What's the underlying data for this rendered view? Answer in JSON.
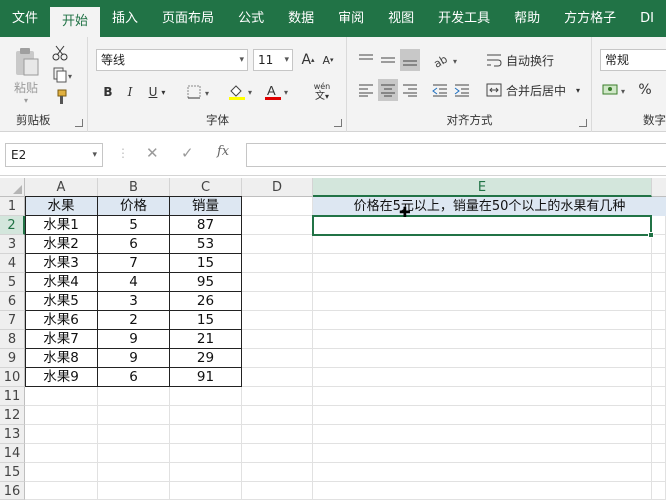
{
  "tabs": [
    "文件",
    "开始",
    "插入",
    "页面布局",
    "公式",
    "数据",
    "审阅",
    "视图",
    "开发工具",
    "帮助",
    "方方格子",
    "DI"
  ],
  "active_tab": "开始",
  "ribbon": {
    "clipboard": {
      "paste": "粘贴",
      "label": "剪贴板"
    },
    "font": {
      "name": "等线",
      "size": "11",
      "grow": "A",
      "shrink": "A",
      "bold": "B",
      "italic": "I",
      "underline": "U",
      "phonetic": "wén",
      "label": "字体"
    },
    "alignment": {
      "wrap": "自动换行",
      "merge": "合并后居中",
      "label": "对齐方式"
    },
    "number": {
      "format": "常规",
      "percent": "%",
      "label": "数字"
    }
  },
  "formula_bar": {
    "name_box": "E2",
    "fx": "fx",
    "value": ""
  },
  "columns": [
    {
      "id": "A",
      "selected": false
    },
    {
      "id": "B",
      "selected": false
    },
    {
      "id": "C",
      "selected": false
    },
    {
      "id": "D",
      "selected": false
    },
    {
      "id": "E",
      "selected": true
    }
  ],
  "rows": [
    "1",
    "2",
    "3",
    "4",
    "5",
    "6",
    "7",
    "8",
    "9",
    "10",
    "11",
    "12",
    "13",
    "14",
    "15",
    "16"
  ],
  "table": {
    "headers": [
      "水果",
      "价格",
      "销量"
    ],
    "rows": [
      [
        "水果1",
        "5",
        "87"
      ],
      [
        "水果2",
        "6",
        "53"
      ],
      [
        "水果3",
        "7",
        "15"
      ],
      [
        "水果4",
        "4",
        "95"
      ],
      [
        "水果5",
        "3",
        "26"
      ],
      [
        "水果6",
        "2",
        "15"
      ],
      [
        "水果7",
        "9",
        "21"
      ],
      [
        "水果8",
        "9",
        "29"
      ],
      [
        "水果9",
        "6",
        "91"
      ]
    ]
  },
  "question": "价格在5元以上，销量在50个以上的水果有几种",
  "accent_color": "#217346"
}
